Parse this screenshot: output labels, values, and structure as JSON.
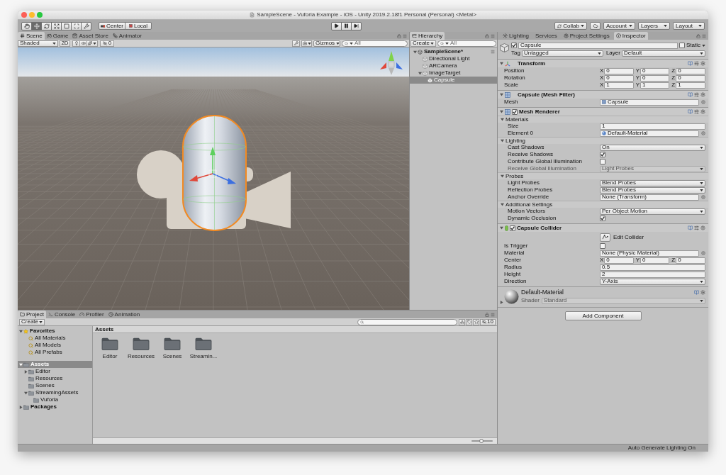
{
  "window": {
    "title": "SampleScene - Vuforia Example - iOS - Unity 2019.2.18f1 Personal (Personal) <Metal>"
  },
  "toolbar": {
    "tools": [
      {
        "kind": "hand",
        "selected": false
      },
      {
        "kind": "move",
        "selected": true
      },
      {
        "kind": "rotate",
        "selected": false
      },
      {
        "kind": "scale",
        "selected": false
      },
      {
        "kind": "rect",
        "selected": false
      },
      {
        "kind": "transform",
        "selected": false
      },
      {
        "kind": "custom",
        "selected": false
      }
    ],
    "pivot": [
      {
        "kind": "pivot",
        "label": "Center"
      },
      {
        "kind": "space",
        "label": "Local"
      }
    ],
    "playback": [
      {
        "kind": "play",
        "selected": false
      },
      {
        "kind": "pause",
        "selected": false
      },
      {
        "kind": "step",
        "selected": false
      }
    ],
    "right": [
      {
        "kind": "collab",
        "label": "Collab"
      },
      {
        "kind": "cloud"
      },
      {
        "kind": "menu",
        "label": "Account"
      },
      {
        "kind": "menu",
        "label": "Layers"
      },
      {
        "kind": "menu",
        "label": "Layout"
      }
    ]
  },
  "scene_panel": {
    "tabs": [
      {
        "kind": "scene",
        "label": "Scene",
        "selected": true
      },
      {
        "kind": "game",
        "label": "Game",
        "selected": false
      },
      {
        "kind": "store",
        "label": "Asset Store",
        "selected": false
      },
      {
        "kind": "animator",
        "label": "Animator",
        "selected": false
      }
    ],
    "draw_mode": "Shaded",
    "mode_2d": "2D",
    "hidden_count": "0",
    "gizmos": "Gizmos",
    "search_placeholder": "All"
  },
  "hierarchy": {
    "tabs": [
      {
        "kind": "hierarchy",
        "label": "Hierarchy",
        "selected": true
      }
    ],
    "create": "Create",
    "search_placeholder": "All",
    "tree": [
      {
        "kind": "scene",
        "label": "SampleScene*",
        "expanded": true,
        "selected": false,
        "children": [
          {
            "kind": "object",
            "label": "Directional Light",
            "selected": false
          },
          {
            "kind": "object",
            "label": "ARCamera",
            "selected": false
          },
          {
            "kind": "object",
            "label": "ImageTarget",
            "expanded": true,
            "selected": false,
            "children": [
              {
                "kind": "object",
                "label": "Capsule",
                "selected": true
              }
            ]
          }
        ]
      }
    ]
  },
  "inspector": {
    "tabs": [
      {
        "kind": "lighting",
        "label": "Lighting",
        "selected": false
      },
      {
        "kind": "services",
        "label": "Services",
        "selected": false
      },
      {
        "kind": "settings",
        "label": "Project Settings",
        "selected": false
      },
      {
        "kind": "inspector",
        "label": "Inspector",
        "selected": true
      }
    ],
    "object": {
      "active": true,
      "name": "Capsule",
      "static": false,
      "static_label": "Static",
      "tag_label": "Tag",
      "tag": "Untagged",
      "layer_label": "Layer",
      "layer": "Default"
    },
    "components": [
      {
        "kind": "transform",
        "title": "Transform",
        "expanded": true,
        "rows": [
          {
            "kind": "vector",
            "label": "Position",
            "axes": [
              {
                "axis": "X",
                "value": "0"
              },
              {
                "axis": "Y",
                "value": "0"
              },
              {
                "axis": "Z",
                "value": "0"
              }
            ]
          },
          {
            "kind": "vector",
            "label": "Rotation",
            "axes": [
              {
                "axis": "X",
                "value": "0"
              },
              {
                "axis": "Y",
                "value": "0"
              },
              {
                "axis": "Z",
                "value": "0"
              }
            ]
          },
          {
            "kind": "vector",
            "label": "Scale",
            "axes": [
              {
                "axis": "X",
                "value": "1"
              },
              {
                "axis": "Y",
                "value": "1"
              },
              {
                "axis": "Z",
                "value": "1"
              }
            ]
          }
        ]
      },
      {
        "kind": "mesh_filter",
        "title": "Capsule (Mesh Filter)",
        "expanded": true,
        "rows": [
          {
            "kind": "mesh_ref",
            "label": "Mesh",
            "value": "Capsule"
          }
        ]
      },
      {
        "kind": "mesh_renderer",
        "title": "Mesh Renderer",
        "expanded": true,
        "enabled": true,
        "rows": [
          {
            "kind": "section",
            "label": "Materials",
            "expanded": true,
            "rows": [
              {
                "kind": "field",
                "label": "Size",
                "value": "1"
              },
              {
                "kind": "material_ref",
                "label": "Element 0",
                "value": "Default-Material"
              }
            ]
          },
          {
            "kind": "section",
            "label": "Lighting",
            "expanded": true,
            "rows": [
              {
                "kind": "dropdown",
                "label": "Cast Shadows",
                "value": "On",
                "disabled": false
              },
              {
                "kind": "checkbox",
                "label": "Receive Shadows",
                "checked": true
              },
              {
                "kind": "checkbox",
                "label": "Contribute Global Illumination",
                "checked": false
              },
              {
                "kind": "dropdown",
                "label": "Receive Global Illumination",
                "value": "Light Probes",
                "disabled": true
              }
            ]
          },
          {
            "kind": "section",
            "label": "Probes",
            "expanded": true,
            "rows": [
              {
                "kind": "dropdown",
                "label": "Light Probes",
                "value": "Blend Probes",
                "disabled": false
              },
              {
                "kind": "dropdown",
                "label": "Reflection Probes",
                "value": "Blend Probes",
                "disabled": false
              },
              {
                "kind": "object_ref",
                "label": "Anchor Override",
                "value": "None (Transform)"
              }
            ]
          },
          {
            "kind": "section",
            "label": "Additional Settings",
            "expanded": true,
            "rows": [
              {
                "kind": "dropdown",
                "label": "Motion Vectors",
                "value": "Per Object Motion",
                "disabled": false
              },
              {
                "kind": "checkbox",
                "label": "Dynamic Occlusion",
                "checked": true
              }
            ]
          }
        ]
      },
      {
        "kind": "capsule_collider",
        "title": "Capsule Collider",
        "expanded": true,
        "enabled": true,
        "rows": [
          {
            "kind": "button",
            "label": "Edit Collider"
          },
          {
            "kind": "checkbox",
            "label": "Is Trigger",
            "checked": false
          },
          {
            "kind": "object_ref",
            "label": "Material",
            "value": "None (Physic Material)"
          },
          {
            "kind": "vector",
            "label": "Center",
            "axes": [
              {
                "axis": "X",
                "value": "0"
              },
              {
                "axis": "Y",
                "value": "0"
              },
              {
                "axis": "Z",
                "value": "0"
              }
            ]
          },
          {
            "kind": "field",
            "label": "Radius",
            "value": "0.5"
          },
          {
            "kind": "field",
            "label": "Height",
            "value": "2"
          },
          {
            "kind": "dropdown",
            "label": "Direction",
            "value": "Y-Axis",
            "disabled": false
          }
        ]
      }
    ],
    "material": {
      "title": "Default-Material",
      "expanded": false,
      "shader_label": "Shader",
      "shader": "Standard"
    },
    "add_component": "Add Component"
  },
  "project": {
    "tabs": [
      {
        "kind": "project",
        "label": "Project",
        "selected": true
      },
      {
        "kind": "console",
        "label": "Console",
        "selected": false
      },
      {
        "kind": "profiler",
        "label": "Profiler",
        "selected": false
      },
      {
        "kind": "animation",
        "label": "Animation",
        "selected": false
      }
    ],
    "create": "Create",
    "hidden_count": "10",
    "tree": [
      {
        "kind": "favorites",
        "label": "Favorites",
        "expanded": true,
        "selected": false,
        "children": [
          {
            "kind": "search",
            "label": "All Materials",
            "selected": false
          },
          {
            "kind": "search",
            "label": "All Models",
            "selected": false
          },
          {
            "kind": "search",
            "label": "All Prefabs",
            "selected": false
          }
        ]
      },
      {
        "kind": "folder",
        "label": "Assets",
        "expanded": true,
        "selected": true,
        "children": [
          {
            "kind": "folder",
            "label": "Editor",
            "expanded": false,
            "selected": false
          },
          {
            "kind": "folder",
            "label": "Resources",
            "selected": false
          },
          {
            "kind": "folder",
            "label": "Scenes",
            "selected": false
          },
          {
            "kind": "folder",
            "label": "StreamingAssets",
            "expanded": true,
            "selected": false,
            "children": [
              {
                "kind": "folder",
                "label": "Vuforia",
                "selected": false
              }
            ]
          }
        ]
      },
      {
        "kind": "folder",
        "label": "Packages",
        "expanded": false,
        "selected": false
      }
    ],
    "breadcrumb": "Assets",
    "items": [
      {
        "label": "Editor"
      },
      {
        "label": "Resources"
      },
      {
        "label": "Scenes"
      },
      {
        "label": "Streamin..."
      }
    ],
    "zoom": {
      "level": 0.45
    }
  },
  "status_bar": {
    "text": "Auto Generate Lighting On"
  }
}
